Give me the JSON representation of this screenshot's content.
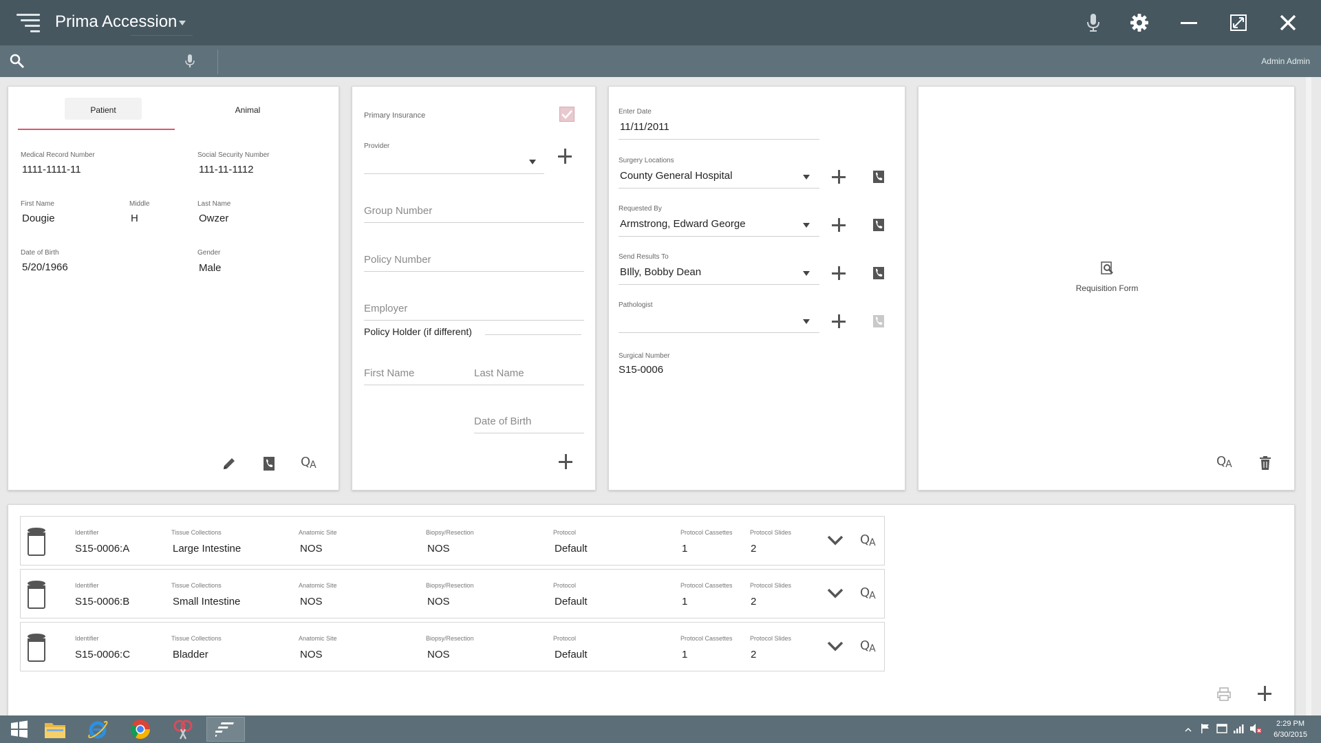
{
  "app": {
    "title": "Prima Accession",
    "user": "Admin Admin"
  },
  "search": {
    "placeholder": ""
  },
  "patient_card": {
    "tabs": [
      "Patient",
      "Animal"
    ],
    "active_tab": "Patient",
    "mrn_label": "Medical Record Number",
    "mrn": "1111-1111-11",
    "ssn_label": "Social Security Number",
    "ssn": "111-11-1112",
    "first_label": "First Name",
    "first": "Dougie",
    "middle_label": "Middle",
    "middle": "H",
    "last_label": "Last Name",
    "last": "Owzer",
    "dob_label": "Date of Birth",
    "dob": "5/20/1966",
    "gender_label": "Gender",
    "gender": "Male"
  },
  "insurance_card": {
    "primary_label": "Primary Insurance",
    "primary_checked": true,
    "provider_label": "Provider",
    "group_placeholder": "Group Number",
    "policy_placeholder": "Policy Number",
    "employer_placeholder": "Employer",
    "holder_label": "Policy Holder (if different)",
    "first_placeholder": "First Name",
    "last_placeholder": "Last Name",
    "dob_placeholder": "Date of Birth"
  },
  "case_card": {
    "enter_date_label": "Enter Date",
    "enter_date": "11/11/2011",
    "surgery_label": "Surgery Locations",
    "surgery": "County General Hospital",
    "requested_label": "Requested By",
    "requested": "Armstrong, Edward George",
    "send_label": "Send Results To",
    "send": "BIlly, Bobby Dean",
    "pathologist_label": "Pathologist",
    "pathologist": "",
    "surgical_label": "Surgical Number",
    "surgical": "S15-0006"
  },
  "requisition": {
    "label": "Requisition Form"
  },
  "specimen_columns": [
    "Identifier",
    "Tissue Collections",
    "Anatomic Site",
    "Biopsy/Resection",
    "Protocol",
    "Protocol Cassettes",
    "Protocol Slides"
  ],
  "specimens": [
    {
      "identifier": "S15-0006:A",
      "tissue": "Large Intestine",
      "site": "NOS",
      "biopsy": "NOS",
      "protocol": "Default",
      "cassettes": "1",
      "slides": "2"
    },
    {
      "identifier": "S15-0006:B",
      "tissue": "Small Intestine",
      "site": "NOS",
      "biopsy": "NOS",
      "protocol": "Default",
      "cassettes": "1",
      "slides": "2"
    },
    {
      "identifier": "S15-0006:C",
      "tissue": "Bladder",
      "site": "NOS",
      "biopsy": "NOS",
      "protocol": "Default",
      "cassettes": "1",
      "slides": "2"
    }
  ],
  "qa_glyph": {
    "q": "Q",
    "a": "A"
  },
  "taskbar": {
    "time": "2:29 PM",
    "date": "6/30/2015"
  },
  "colors": {
    "titlebar": "#465760",
    "searchbar": "#5f727b",
    "accent": "#e0546a"
  }
}
